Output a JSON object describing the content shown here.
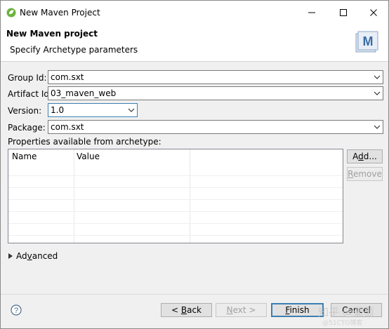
{
  "window": {
    "title": "New Maven Project"
  },
  "header": {
    "title": "New Maven project",
    "subtitle": "Specify Archetype parameters",
    "logo_letter": "M"
  },
  "form": {
    "group_id": {
      "label": "Group Id:",
      "value": "com.sxt"
    },
    "artifact_id": {
      "label": "Artifact Id:",
      "value": "03_maven_web"
    },
    "version": {
      "label": "Version:",
      "value": "1.0"
    },
    "package": {
      "label": "Package:",
      "value": "com.sxt"
    }
  },
  "properties": {
    "label": "Properties available from archetype:",
    "columns": [
      "Name",
      "Value"
    ],
    "add_label_pre": "A",
    "add_label_ul": "d",
    "add_label_post": "d...",
    "remove_label_pre": "",
    "remove_label_ul": "R",
    "remove_label_post": "emove"
  },
  "advanced": {
    "label_pre": "Ad",
    "label_ul": "v",
    "label_post": "anced"
  },
  "footer": {
    "back": {
      "pre": "< ",
      "ul": "B",
      "post": "ack"
    },
    "next": {
      "pre": "",
      "ul": "N",
      "post": "ext >"
    },
    "finish": {
      "pre": "",
      "ul": "F",
      "post": "inish"
    },
    "cancel": "Cancel"
  },
  "watermark": {
    "line1": "知乎 @葡萄",
    "line2": "@51CTO博客"
  },
  "colors": {
    "focus_border": "#3c7fb1",
    "maven_blue": "#3a6ea5"
  }
}
